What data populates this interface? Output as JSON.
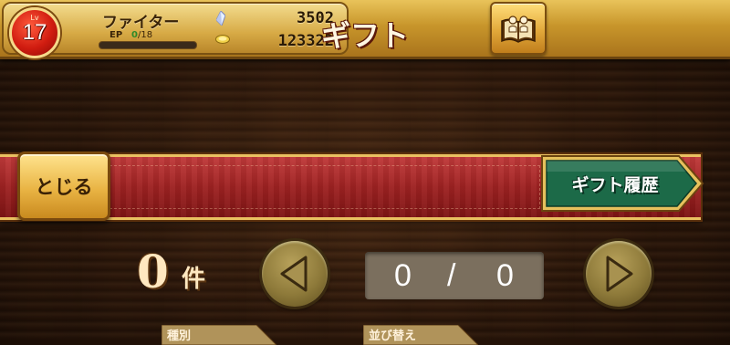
{
  "header": {
    "level_label": "Lv",
    "level": "17",
    "player_name": "ファイター",
    "ep_label": "EP",
    "ep_current": "0",
    "ep_max": "/18",
    "ep_progress": 0,
    "gem_count": "3502",
    "coin_count": "123322",
    "icons": {
      "gem": "crystal-icon",
      "coin": "gold-coin-icon",
      "book": "open-book-icon"
    }
  },
  "banner": {
    "title": "ギフト",
    "close_label": "とじる",
    "history_label": "ギフト履歴"
  },
  "pager": {
    "count": "0",
    "count_unit": "件",
    "page_current": "0",
    "page_separator": "/",
    "page_total": "0"
  },
  "filters": {
    "type_label": "種別",
    "sort_label": "並び替え"
  },
  "colors": {
    "banner_red": "#9e2222",
    "gold": "#e2a83a",
    "history_green": "#1c6a48"
  }
}
